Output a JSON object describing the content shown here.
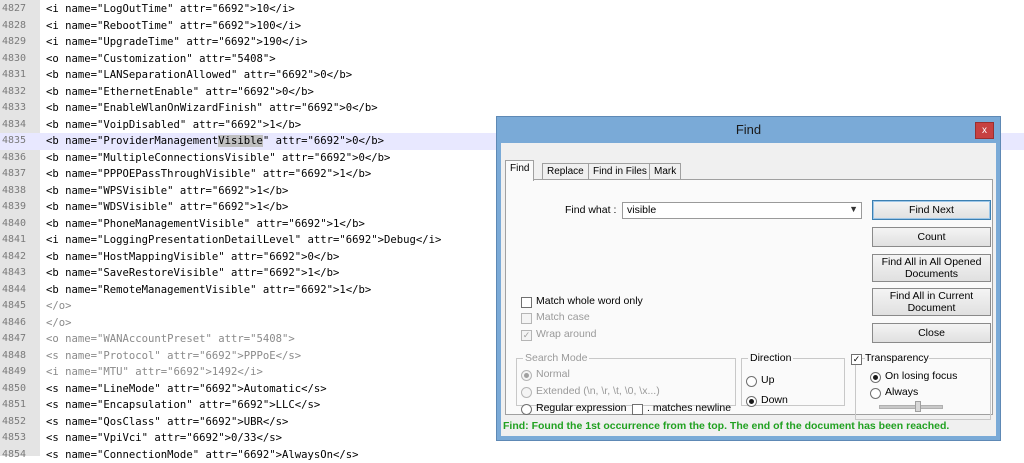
{
  "editor": {
    "lines": [
      {
        "num": "4827",
        "text": "<i name=\"LogOutTime\" attr=\"6692\">10</i>",
        "dim": false
      },
      {
        "num": "4828",
        "text": "<i name=\"RebootTime\" attr=\"6692\">100</i>",
        "dim": false
      },
      {
        "num": "4829",
        "text": "<i name=\"UpgradeTime\" attr=\"6692\">190</i>",
        "dim": false
      },
      {
        "num": "4830",
        "text": "<o name=\"Customization\" attr=\"5408\">",
        "dim": false
      },
      {
        "num": "4831",
        "text": "<b name=\"LANSeparationAllowed\" attr=\"6692\">0</b>",
        "dim": false
      },
      {
        "num": "4832",
        "text": "<b name=\"EthernetEnable\" attr=\"6692\">0</b>",
        "dim": false
      },
      {
        "num": "4833",
        "text": "<b name=\"EnableWlanOnWizardFinish\" attr=\"6692\">0</b>",
        "dim": false
      },
      {
        "num": "4834",
        "text": "<b name=\"VoipDisabled\" attr=\"6692\">1</b>",
        "dim": false
      },
      {
        "num": "4835",
        "text": "<b name=\"ProviderManagementVisible\" attr=\"6692\">0</b>",
        "dim": false,
        "current": true,
        "highlight": "Visible"
      },
      {
        "num": "4836",
        "text": "<b name=\"MultipleConnectionsVisible\" attr=\"6692\">0</b>",
        "dim": false
      },
      {
        "num": "4837",
        "text": "<b name=\"PPPOEPassThroughVisible\" attr=\"6692\">1</b>",
        "dim": false
      },
      {
        "num": "4838",
        "text": "<b name=\"WPSVisible\" attr=\"6692\">1</b>",
        "dim": false
      },
      {
        "num": "4839",
        "text": "<b name=\"WDSVisible\" attr=\"6692\">1</b>",
        "dim": false
      },
      {
        "num": "4840",
        "text": "<b name=\"PhoneManagementVisible\" attr=\"6692\">1</b>",
        "dim": false
      },
      {
        "num": "4841",
        "text": "<i name=\"LoggingPresentationDetailLevel\" attr=\"6692\">Debug</i>",
        "dim": false
      },
      {
        "num": "4842",
        "text": "<b name=\"HostMappingVisible\" attr=\"6692\">0</b>",
        "dim": false
      },
      {
        "num": "4843",
        "text": "<b name=\"SaveRestoreVisible\" attr=\"6692\">1</b>",
        "dim": false
      },
      {
        "num": "4844",
        "text": "<b name=\"RemoteManagementVisible\" attr=\"6692\">1</b>",
        "dim": false
      },
      {
        "num": "4845",
        "text": "</o>",
        "dim": true
      },
      {
        "num": "4846",
        "text": "</o>",
        "dim": true
      },
      {
        "num": "4847",
        "text": "<o name=\"WANAccountPreset\" attr=\"5408\">",
        "dim": true
      },
      {
        "num": "4848",
        "text": "<s name=\"Protocol\" attr=\"6692\">PPPoE</s>",
        "dim": true
      },
      {
        "num": "4849",
        "text": "<i name=\"MTU\" attr=\"6692\">1492</i>",
        "dim": true
      },
      {
        "num": "4850",
        "text": "<s name=\"LineMode\" attr=\"6692\">Automatic</s>",
        "dim": false
      },
      {
        "num": "4851",
        "text": "<s name=\"Encapsulation\" attr=\"6692\">LLC</s>",
        "dim": false
      },
      {
        "num": "4852",
        "text": "<s name=\"QosClass\" attr=\"6692\">UBR</s>",
        "dim": false
      },
      {
        "num": "4853",
        "text": "<s name=\"VpiVci\" attr=\"6692\">0/33</s>",
        "dim": false
      },
      {
        "num": "4854",
        "text": "<s name=\"ConnectionMode\" attr=\"6692\">AlwaysOn</s>",
        "dim": false
      }
    ]
  },
  "dialog": {
    "title": "Find",
    "close_glyph": "x",
    "tabs": [
      "Find",
      "Replace",
      "Find in Files",
      "Mark"
    ],
    "find_what_label": "Find what :",
    "find_what_value": "visible",
    "buttons": {
      "find_next": "Find Next",
      "count": "Count",
      "find_all_opened": "Find All in All Opened Documents",
      "find_all_current": "Find All in Current Document",
      "close": "Close"
    },
    "options": {
      "match_whole_word": "Match whole word only",
      "match_case": "Match case",
      "wrap_around": "Wrap around"
    },
    "search_mode": {
      "title": "Search Mode",
      "normal": "Normal",
      "extended": "Extended (\\n, \\r, \\t, \\0, \\x...)",
      "regex": "Regular expression",
      "matches_newline": ". matches newline"
    },
    "direction": {
      "title": "Direction",
      "up": "Up",
      "down": "Down"
    },
    "transparency": {
      "title": "Transparency",
      "on_losing_focus": "On losing focus",
      "always": "Always"
    },
    "status": "Find: Found the 1st occurrence from the top. The end of the document has been reached."
  }
}
